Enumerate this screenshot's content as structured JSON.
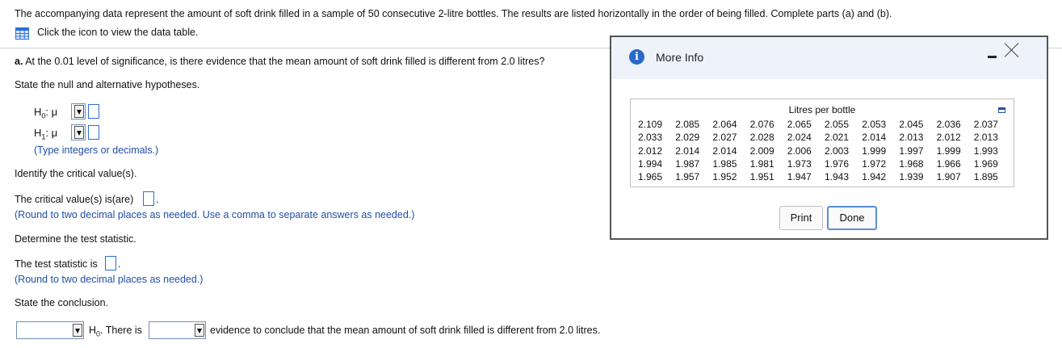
{
  "intro": "The accompanying data represent the amount of soft drink filled in a sample of 50 consecutive 2-litre bottles. The results are listed horizontally in the order of being filled. Complete parts (a) and (b).",
  "data_link": "Click the icon to view the data table.",
  "part_a": {
    "label": "a.",
    "question": " At the 0.01 level of significance, is there evidence that the mean amount of soft drink filled is different from 2.0 litres?"
  },
  "hypotheses": {
    "prompt": "State the null and alternative hypotheses.",
    "h0_label": "H",
    "h0_sub": "0",
    "h1_label": "H",
    "h1_sub": "1",
    "mu": ": μ",
    "hint": "(Type integers or decimals.)"
  },
  "critical": {
    "prompt": "Identify the critical value(s).",
    "answer_prefix": "The critical value(s) is(are)",
    "period": ".",
    "hint": "(Round to two decimal places as needed. Use a comma to separate answers as needed.)"
  },
  "test_stat": {
    "prompt": "Determine the test statistic.",
    "answer_prefix": "The test statistic is",
    "period": ".",
    "hint": "(Round to two decimal places as needed.)"
  },
  "conclusion": {
    "prompt": "State the conclusion.",
    "h0_label": "H",
    "h0_sub": "0",
    "middle": ". There is",
    "suffix": "evidence to conclude that the mean amount of soft drink filled is different from 2.0 litres."
  },
  "modal": {
    "title": "More Info",
    "table_header": "Litres per bottle",
    "rows": [
      [
        "2.109",
        "2.085",
        "2.064",
        "2.076",
        "2.065",
        "2.055",
        "2.053",
        "2.045",
        "2.036",
        "2.037"
      ],
      [
        "2.033",
        "2.029",
        "2.027",
        "2.028",
        "2.024",
        "2.021",
        "2.014",
        "2.013",
        "2.012",
        "2.013"
      ],
      [
        "2.012",
        "2.014",
        "2.014",
        "2.009",
        "2.006",
        "2.003",
        "1.999",
        "1.997",
        "1.999",
        "1.993"
      ],
      [
        "1.994",
        "1.987",
        "1.985",
        "1.981",
        "1.973",
        "1.976",
        "1.972",
        "1.968",
        "1.966",
        "1.969"
      ],
      [
        "1.965",
        "1.957",
        "1.952",
        "1.951",
        "1.947",
        "1.943",
        "1.942",
        "1.939",
        "1.907",
        "1.895"
      ]
    ],
    "print_label": "Print",
    "done_label": "Done"
  },
  "colors": {
    "link": "#1f4fa8",
    "accent": "#2a6fd6",
    "modal_header": "#eef3fa"
  },
  "icons": [
    "table-icon",
    "info-icon",
    "minimize-icon",
    "close-icon",
    "copy-icon",
    "chevron-down-icon"
  ]
}
